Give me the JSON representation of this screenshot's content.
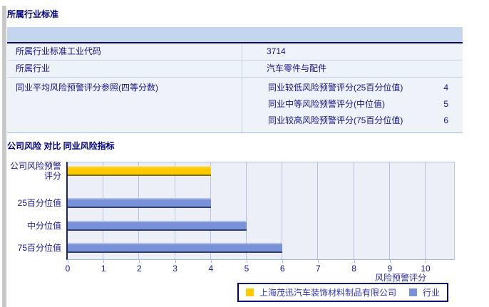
{
  "colors": {
    "company": "#FFCB00",
    "industry": "#7991D8",
    "header_band": "#C5D5EE",
    "text_navy": "#14148A"
  },
  "section1": {
    "title": "所属行业标准",
    "rows": [
      {
        "label": "所属行业标准工业代码",
        "value": "3714"
      },
      {
        "label": "所属行业",
        "value": "汽车零件与配件"
      },
      {
        "label": "同业平均风险预警评分参照(四等分数)",
        "subrows": [
          {
            "label": "同业较低风险预警评分(25百分位值)",
            "value": "4"
          },
          {
            "label": "同业中等风险预警评分(中位值)",
            "value": "5"
          },
          {
            "label": "同业较高风险预警评分(75百分位值)",
            "value": "6"
          }
        ]
      }
    ]
  },
  "section2": {
    "title": "公司风险 对比 同业风险指标"
  },
  "chart_data": {
    "type": "bar",
    "orientation": "horizontal",
    "title": "",
    "categories": [
      "公司风险预警评分",
      "25百分位值",
      "中分位值",
      "75百分位值"
    ],
    "values": [
      4,
      4,
      5,
      6
    ],
    "bar_series": [
      0,
      1,
      1,
      1
    ],
    "xlabel": "风险预警评分",
    "ylabel": "",
    "xlim": [
      0,
      10
    ],
    "xticks": [
      0,
      1,
      2,
      3,
      4,
      5,
      6,
      7,
      8,
      9,
      10
    ],
    "grid": true,
    "legend_position": "bottom",
    "legend": [
      {
        "name": "company",
        "label": "上海茂迅汽车装饰材料制品有限公司",
        "color": "#FFCB00"
      },
      {
        "name": "industry",
        "label": "行业",
        "color": "#7991D8"
      }
    ]
  }
}
